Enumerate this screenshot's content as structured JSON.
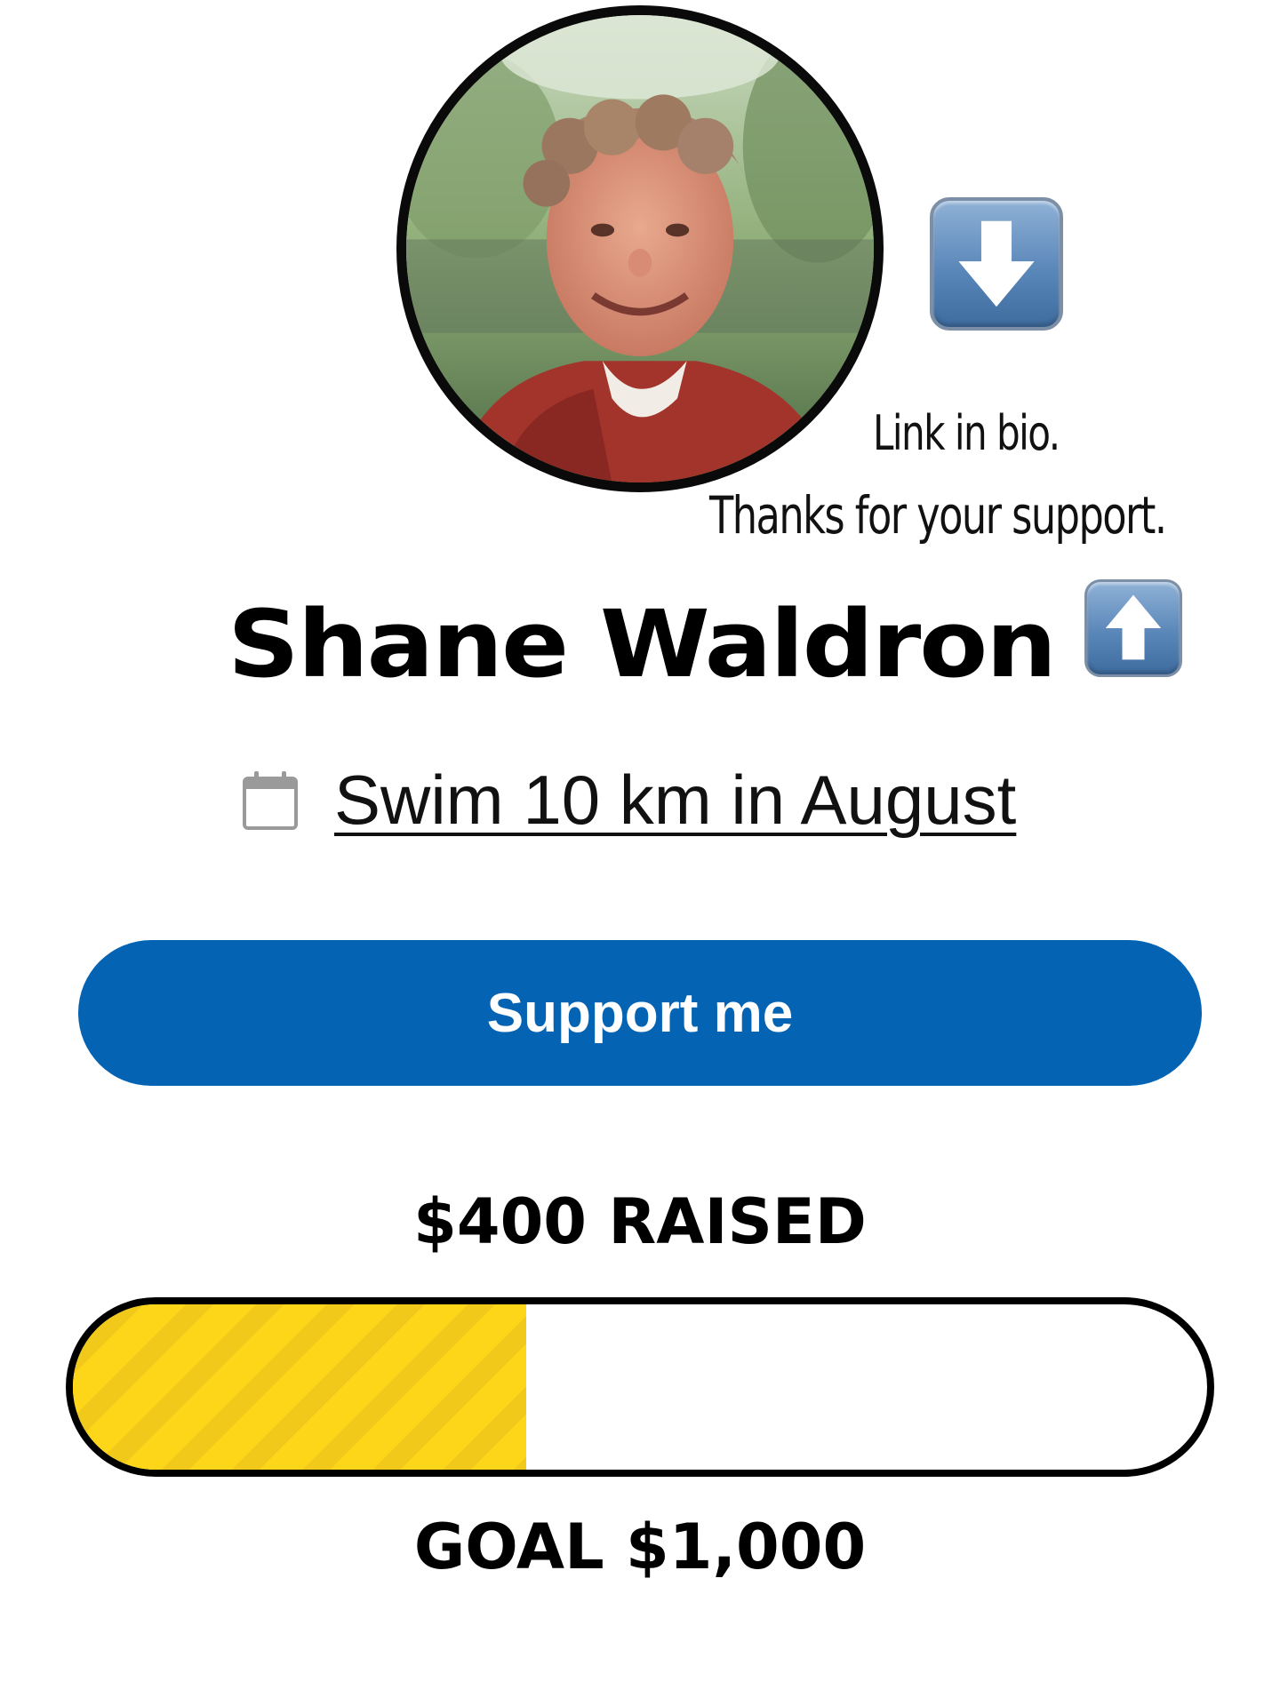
{
  "profile": {
    "name": "Shane Waldron",
    "avatar_icon": "profile-photo"
  },
  "bio_note": {
    "line1": "Link in bio.",
    "line2": "Thanks for your support.",
    "down_icon": "arrow-down-icon",
    "up_icon": "arrow-up-icon"
  },
  "event": {
    "icon": "calendar-icon",
    "label": "Swim 10 km in August"
  },
  "actions": {
    "support_label": "Support me"
  },
  "fundraising": {
    "raised_label": "$400 RAISED",
    "raised_amount": 400,
    "goal_label": "GOAL $1,000",
    "goal_amount": 1000,
    "progress_fraction": 0.4
  },
  "colors": {
    "button": "#0563b3",
    "progress_fill": "#fdd61a",
    "progress_border": "#000000"
  }
}
